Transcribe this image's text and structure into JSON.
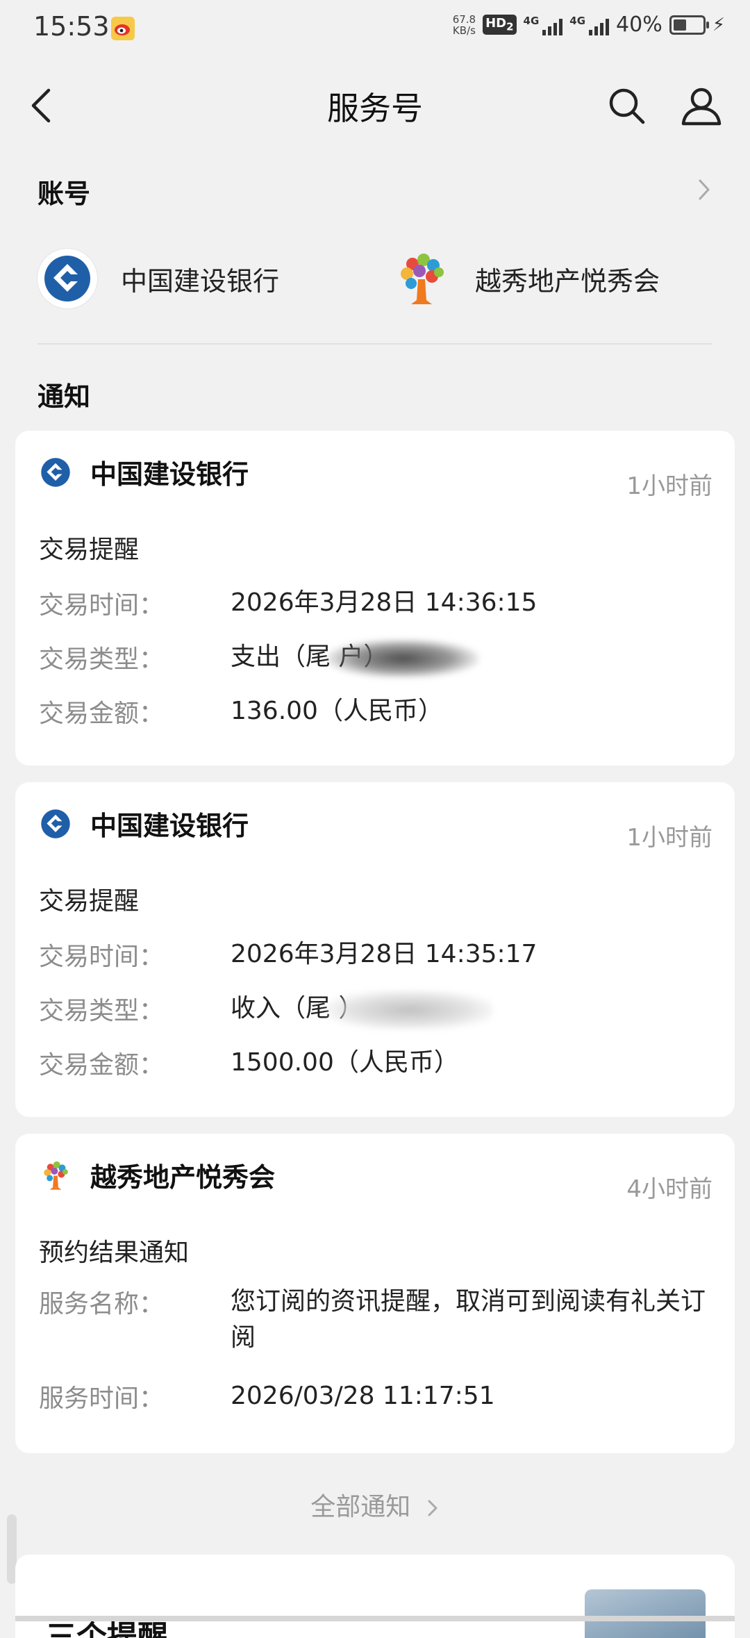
{
  "status_bar": {
    "time": "15:53",
    "net_speed_value": "67.8",
    "net_speed_unit": "KB/s",
    "hd": "HD",
    "hd_sub": "2",
    "sim1": "4G",
    "sim2": "4G",
    "battery": "40%"
  },
  "nav": {
    "title": "服务号"
  },
  "account_section": {
    "title": "账号",
    "accounts": [
      {
        "name": "中国建设银行",
        "icon": "ccb-logo"
      },
      {
        "name": "越秀地产悦秀会",
        "icon": "yuexiu-tree-logo"
      }
    ]
  },
  "notice_section": {
    "title": "通知",
    "notices": [
      {
        "source": "中国建设银行",
        "time": "1小时前",
        "subject": "交易提醒",
        "rows": [
          {
            "label": "交易时间：",
            "value": "2026年3月28日 14:36:15"
          },
          {
            "label": "交易类型：",
            "value": "支出（尾            户）"
          },
          {
            "label": "交易金额：",
            "value": "136.00（人民币）"
          }
        ]
      },
      {
        "source": "中国建设银行",
        "time": "1小时前",
        "subject": "交易提醒",
        "rows": [
          {
            "label": "交易时间：",
            "value": "2026年3月28日 14:35:17"
          },
          {
            "label": "交易类型：",
            "value": "收入（尾               ）"
          },
          {
            "label": "交易金额：",
            "value": "1500.00（人民币）"
          }
        ]
      },
      {
        "source": "越秀地产悦秀会",
        "time": "4小时前",
        "subject": "预约结果通知",
        "rows": [
          {
            "label": "服务名称：",
            "value": "您订阅的资讯提醒，取消可到阅读有礼关订阅"
          },
          {
            "label": "服务时间：",
            "value": "2026/03/28 11:17:51"
          }
        ]
      }
    ],
    "all_link": "全部通知"
  },
  "bottom": {
    "title_partial": "三个提醒"
  },
  "colors": {
    "background": "#f1f1f1",
    "card": "#ffffff",
    "muted_text": "#8c8c8c",
    "ccb_blue": "#1f5fa8"
  }
}
